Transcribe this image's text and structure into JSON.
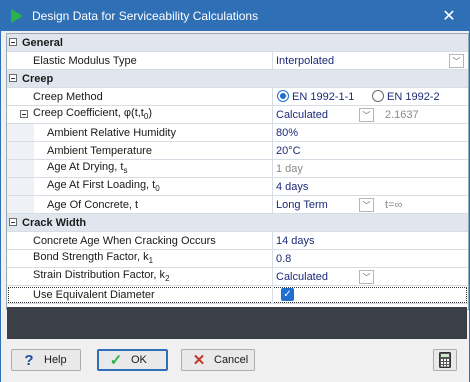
{
  "window": {
    "title": "Design Data for Serviceability Calculations",
    "close_glyph": "✕"
  },
  "general": {
    "header": "General",
    "rows": [
      {
        "label": "Elastic Modulus Type",
        "value": "Interpolated"
      }
    ]
  },
  "creep": {
    "header": "Creep",
    "method_label": "Creep Method",
    "method_options": [
      "EN 1992-1-1",
      "EN 1992-2"
    ],
    "method_selected": "EN 1992-1-1",
    "coef_label": "Creep Coefficient, φ(t,t",
    "coef_sub": "0",
    "coef_close": ")",
    "coef_value": "Calculated",
    "coef_result": "2.1637",
    "humidity_label": "Ambient Relative Humidity",
    "humidity_value": "80%",
    "temp_label": "Ambient Temperature",
    "temp_value": "20°C",
    "drying_label": "Age At Drying, t",
    "drying_sub": "s",
    "drying_value": "1 day",
    "loading_label": "Age At First Loading, t",
    "loading_sub": "0",
    "loading_value": "4 days",
    "age_label": "Age Of Concrete, t",
    "age_value": "Long Term",
    "age_extra": "t=∞"
  },
  "crack": {
    "header": "Crack Width",
    "cracking_label": "Concrete Age When Cracking Occurs",
    "cracking_value": "14 days",
    "bond_label": "Bond Strength Factor, k",
    "bond_sub": "1",
    "bond_value": "0.8",
    "strain_label": "Strain Distribution Factor, k",
    "strain_sub": "2",
    "strain_value": "Calculated",
    "equiv_label": "Use Equivalent Diameter",
    "equiv_checked": true
  },
  "footer": {
    "help_label": "Help",
    "ok_label": "OK",
    "cancel_label": "Cancel"
  },
  "colors": {
    "titlebar": "#2f6fb5",
    "section": "#dfe6ee",
    "value_text": "#1c2a7a",
    "ok_check": "#2bb24c",
    "cancel_x": "#c0392b"
  }
}
